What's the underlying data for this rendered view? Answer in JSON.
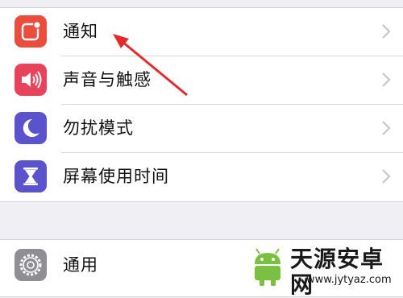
{
  "settings": {
    "rows": [
      {
        "label": "通知",
        "icon": "notifications-icon",
        "color": "#e74c3c"
      },
      {
        "label": "声音与触感",
        "icon": "speaker-icon",
        "color": "#e8455a"
      },
      {
        "label": "勿扰模式",
        "icon": "moon-icon",
        "color": "#5a52c8"
      },
      {
        "label": "屏幕使用时间",
        "icon": "hourglass-icon",
        "color": "#5a52c8"
      }
    ],
    "general": {
      "label": "通用",
      "icon": "gear-icon",
      "color": "#8e8e93"
    }
  },
  "watermark": {
    "title": "天源安卓网",
    "url": "www.jytyaz.com"
  }
}
